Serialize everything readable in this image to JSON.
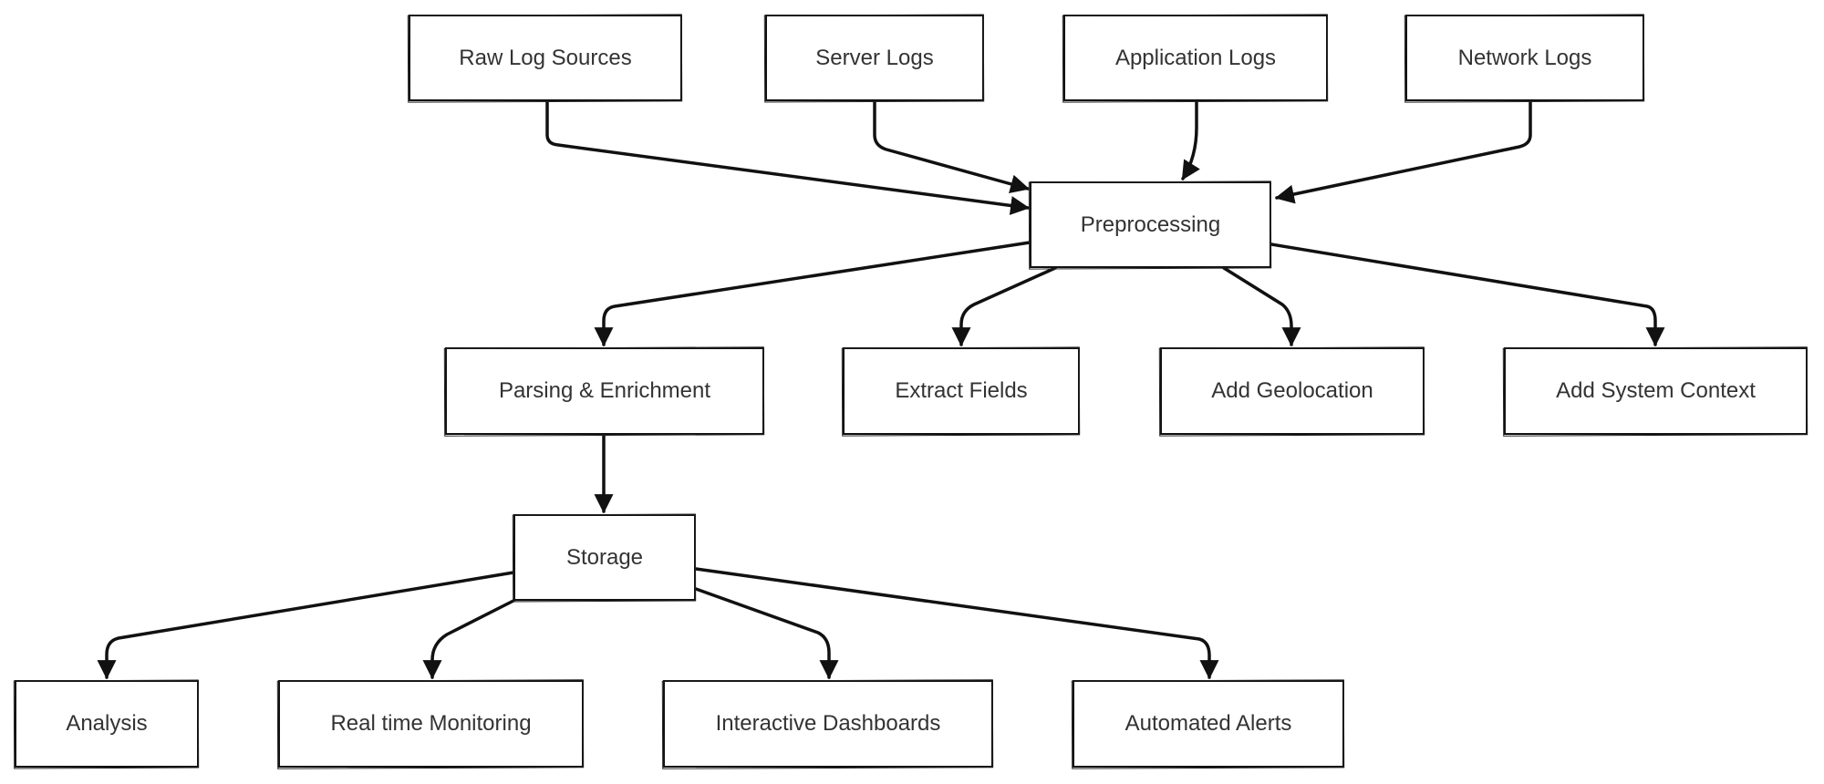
{
  "diagram": {
    "type": "flowchart",
    "nodes": [
      {
        "id": "raw",
        "label": "Raw Log Sources"
      },
      {
        "id": "server",
        "label": "Server Logs"
      },
      {
        "id": "app",
        "label": "Application Logs"
      },
      {
        "id": "network",
        "label": "Network Logs"
      },
      {
        "id": "pre",
        "label": "Preprocessing"
      },
      {
        "id": "parse",
        "label": "Parsing & Enrichment"
      },
      {
        "id": "extract",
        "label": "Extract Fields"
      },
      {
        "id": "geo",
        "label": "Add Geolocation"
      },
      {
        "id": "ctx",
        "label": "Add System Context"
      },
      {
        "id": "storage",
        "label": "Storage"
      },
      {
        "id": "analysis",
        "label": "Analysis"
      },
      {
        "id": "rtm",
        "label": "Real time Monitoring"
      },
      {
        "id": "dash",
        "label": "Interactive Dashboards"
      },
      {
        "id": "alerts",
        "label": "Automated Alerts"
      }
    ],
    "edges": [
      {
        "from": "raw",
        "to": "pre"
      },
      {
        "from": "server",
        "to": "pre"
      },
      {
        "from": "app",
        "to": "pre"
      },
      {
        "from": "network",
        "to": "pre"
      },
      {
        "from": "pre",
        "to": "parse"
      },
      {
        "from": "pre",
        "to": "extract"
      },
      {
        "from": "pre",
        "to": "geo"
      },
      {
        "from": "pre",
        "to": "ctx"
      },
      {
        "from": "parse",
        "to": "storage"
      },
      {
        "from": "storage",
        "to": "analysis"
      },
      {
        "from": "storage",
        "to": "rtm"
      },
      {
        "from": "storage",
        "to": "dash"
      },
      {
        "from": "storage",
        "to": "alerts"
      }
    ]
  }
}
